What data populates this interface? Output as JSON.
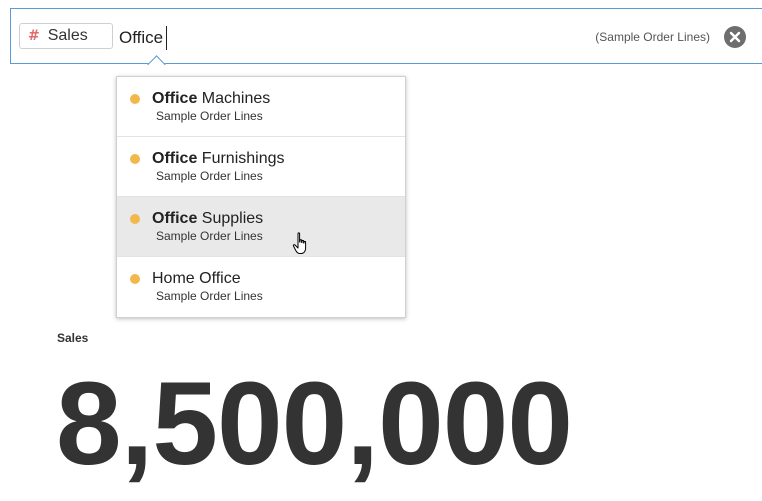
{
  "search": {
    "chip_label": "Sales",
    "chip_icon": "hash-icon",
    "query": "Office",
    "context": "(Sample Order Lines)",
    "clear_icon": "close-circle-icon"
  },
  "suggestions": [
    {
      "match": "Office",
      "rest": " Machines",
      "source": "Sample Order Lines",
      "highlighted": false
    },
    {
      "match": "Office",
      "rest": " Furnishings",
      "source": "Sample Order Lines",
      "highlighted": false
    },
    {
      "match": "Office",
      "rest": " Supplies",
      "source": "Sample Order Lines",
      "highlighted": true
    },
    {
      "match": "",
      "rest": "Home Office",
      "source": "Sample Order Lines",
      "highlighted": false
    }
  ],
  "metric": {
    "label": "Sales",
    "value": "8,500,000"
  },
  "colors": {
    "accent": "#5b9bd5",
    "dot": "#f2b84b",
    "hash": "#e06b6b"
  }
}
